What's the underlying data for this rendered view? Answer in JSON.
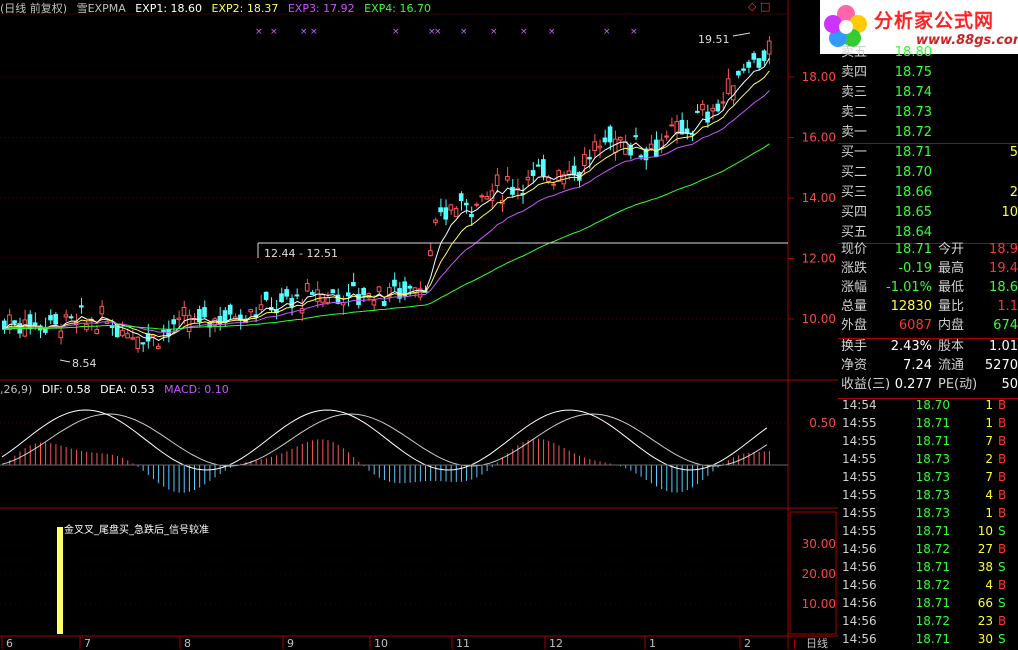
{
  "header": {
    "period": "日线",
    "adjust": "前复权",
    "indicator": "雪EXPMA",
    "exp1": "EXP1: 18.60",
    "exp2": "EXP2: 18.37",
    "exp3": "EXP3: 17.92",
    "exp4": "EXP4: 16.70",
    "colors": {
      "exp1": "#ffffff",
      "exp2": "#ffff55",
      "exp3": "#cc55ff",
      "exp4": "#33ff33"
    }
  },
  "macd_header": {
    "params": ",26,9)",
    "dif": "DIF: 0.58",
    "dea": "DEA: 0.53",
    "macd": "MACD: 0.10"
  },
  "annotations": {
    "high": "19.51",
    "low": "8.54",
    "range": "12.44 - 12.51",
    "signal_text": "金叉叉_尾盘买_急跌后_信号较准"
  },
  "price_axis": [
    "18.00",
    "16.00",
    "14.00",
    "12.00",
    "10.00"
  ],
  "macd_axis": [
    "0.50"
  ],
  "vol_axis": [
    "30.00",
    "20.00",
    "10.00"
  ],
  "month_labels": [
    "6",
    "7",
    "8",
    "9",
    "10",
    "11",
    "12",
    "1",
    "2"
  ],
  "bottom_tab": "日线",
  "logo": {
    "text": "分析家公式网",
    "url": "www.88gs.com"
  },
  "quote": {
    "sell": [
      {
        "label": "卖五",
        "price": "18.80"
      },
      {
        "label": "卖四",
        "price": "18.75"
      },
      {
        "label": "卖三",
        "price": "18.74"
      },
      {
        "label": "卖二",
        "price": "18.73"
      },
      {
        "label": "卖一",
        "price": "18.72"
      }
    ],
    "buy": [
      {
        "label": "买一",
        "price": "18.71",
        "vol": "5"
      },
      {
        "label": "买二",
        "price": "18.70",
        "vol": ""
      },
      {
        "label": "买三",
        "price": "18.66",
        "vol": "2"
      },
      {
        "label": "买四",
        "price": "18.65",
        "vol": "10"
      },
      {
        "label": "买五",
        "price": "18.64",
        "vol": ""
      }
    ],
    "stats": [
      {
        "l1": "现价",
        "v1": "18.71",
        "c1": "green",
        "l2": "今开",
        "v2": "18.9",
        "c2": "red"
      },
      {
        "l1": "涨跌",
        "v1": "-0.19",
        "c1": "green",
        "l2": "最高",
        "v2": "19.4",
        "c2": "red"
      },
      {
        "l1": "涨幅",
        "v1": "-1.01%",
        "c1": "green",
        "l2": "最低",
        "v2": "18.6",
        "c2": "green"
      },
      {
        "l1": "总量",
        "v1": "12830",
        "c1": "yellow",
        "l2": "量比",
        "v2": "1.1",
        "c2": "red"
      },
      {
        "l1": "外盘",
        "v1": "6087",
        "c1": "red",
        "l2": "内盘",
        "v2": "674",
        "c2": "green"
      }
    ],
    "info": [
      {
        "l1": "换手",
        "v1": "2.43%",
        "l2": "股本",
        "v2": "1.01"
      },
      {
        "l1": "净资",
        "v1": "7.24",
        "l2": "流通",
        "v2": "5270"
      },
      {
        "l1": "收益(三)",
        "v1": "0.277",
        "l2": "PE(动)",
        "v2": "50"
      }
    ]
  },
  "ticks": [
    {
      "time": "14:54",
      "price": "18.70",
      "vol": "1",
      "side": "B",
      "pc": "green"
    },
    {
      "time": "14:55",
      "price": "18.71",
      "vol": "1",
      "side": "B",
      "pc": "green"
    },
    {
      "time": "14:55",
      "price": "18.71",
      "vol": "7",
      "side": "B",
      "pc": "green"
    },
    {
      "time": "14:55",
      "price": "18.73",
      "vol": "2",
      "side": "B",
      "pc": "green"
    },
    {
      "time": "14:55",
      "price": "18.73",
      "vol": "7",
      "side": "B",
      "pc": "green"
    },
    {
      "time": "14:55",
      "price": "18.73",
      "vol": "4",
      "side": "B",
      "pc": "green"
    },
    {
      "time": "14:55",
      "price": "18.73",
      "vol": "1",
      "side": "B",
      "pc": "green"
    },
    {
      "time": "14:55",
      "price": "18.71",
      "vol": "10",
      "side": "S",
      "pc": "green"
    },
    {
      "time": "14:56",
      "price": "18.72",
      "vol": "27",
      "side": "B",
      "pc": "green"
    },
    {
      "time": "14:56",
      "price": "18.71",
      "vol": "38",
      "side": "S",
      "pc": "green"
    },
    {
      "time": "14:56",
      "price": "18.72",
      "vol": "4",
      "side": "B",
      "pc": "green"
    },
    {
      "time": "14:56",
      "price": "18.71",
      "vol": "66",
      "side": "S",
      "pc": "green"
    },
    {
      "time": "14:56",
      "price": "18.72",
      "vol": "23",
      "side": "B",
      "pc": "green"
    },
    {
      "time": "14:56",
      "price": "18.71",
      "vol": "30",
      "side": "S",
      "pc": "green"
    }
  ]
}
